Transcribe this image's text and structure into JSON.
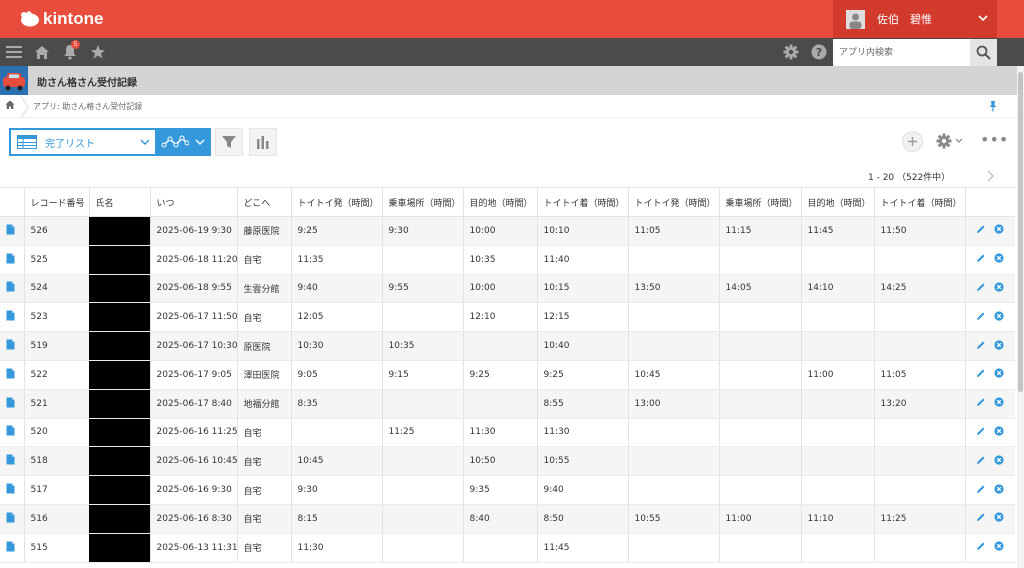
{
  "header": {
    "logo_text": "kintone",
    "user_name": "佐伯　碧惟",
    "brand_color": "#e74c3c"
  },
  "nav": {
    "notification_count": "5",
    "search_placeholder": "アプリ内検索",
    "icons": [
      "menu-icon",
      "home-icon",
      "bell-icon",
      "star-icon",
      "gear-icon",
      "help-icon",
      "search-icon"
    ]
  },
  "app": {
    "title": "助さん格さん受付記録"
  },
  "breadcrumb": {
    "text": "アプリ: 助さん格さん受付記録"
  },
  "toolbar": {
    "view_name": "完了リスト",
    "accent_color": "#3498db"
  },
  "pager": {
    "range": "1 - 20 （522件中）"
  },
  "table": {
    "columns": [
      "",
      "レコード番号",
      "氏名",
      "いつ",
      "どこへ",
      "トイトイ発（時間）",
      "乗車場所（時間）",
      "目的地（時間）",
      "トイトイ着（時間）",
      "トイトイ発（時間）",
      "乗車場所（時間）",
      "目的地（時間）",
      "トイトイ着（時間）",
      ""
    ],
    "rows": [
      {
        "id": "526",
        "name": "",
        "when": "2025-06-19 9:30",
        "where": "藤原医院",
        "c1": "9:25",
        "c2": "9:30",
        "c3": "10:00",
        "c4": "10:10",
        "c5": "11:05",
        "c6": "11:15",
        "c7": "11:45",
        "c8": "11:50"
      },
      {
        "id": "525",
        "name": "",
        "when": "2025-06-18 11:20",
        "where": "自宅",
        "c1": "11:35",
        "c2": "",
        "c3": "10:35",
        "c4": "11:40",
        "c5": "",
        "c6": "",
        "c7": "",
        "c8": ""
      },
      {
        "id": "524",
        "name": "",
        "when": "2025-06-18 9:55",
        "where": "生雲分館",
        "c1": "9:40",
        "c2": "9:55",
        "c3": "10:00",
        "c4": "10:15",
        "c5": "13:50",
        "c6": "14:05",
        "c7": "14:10",
        "c8": "14:25"
      },
      {
        "id": "523",
        "name": "",
        "when": "2025-06-17 11:50",
        "where": "自宅",
        "c1": "12:05",
        "c2": "",
        "c3": "12:10",
        "c4": "12:15",
        "c5": "",
        "c6": "",
        "c7": "",
        "c8": ""
      },
      {
        "id": "519",
        "name": "",
        "when": "2025-06-17 10:30",
        "where": "原医院",
        "c1": "10:30",
        "c2": "10:35",
        "c3": "",
        "c4": "10:40",
        "c5": "",
        "c6": "",
        "c7": "",
        "c8": ""
      },
      {
        "id": "522",
        "name": "",
        "when": "2025-06-17 9:05",
        "where": "澤田医院",
        "c1": "9:05",
        "c2": "9:15",
        "c3": "9:25",
        "c4": "9:25",
        "c5": "10:45",
        "c6": "",
        "c7": "11:00",
        "c8": "11:05"
      },
      {
        "id": "521",
        "name": "",
        "when": "2025-06-17 8:40",
        "where": "地福分館",
        "c1": "8:35",
        "c2": "",
        "c3": "",
        "c4": "8:55",
        "c5": "13:00",
        "c6": "",
        "c7": "",
        "c8": "13:20"
      },
      {
        "id": "520",
        "name": "",
        "when": "2025-06-16 11:25",
        "where": "自宅",
        "c1": "",
        "c2": "11:25",
        "c3": "11:30",
        "c4": "11:30",
        "c5": "",
        "c6": "",
        "c7": "",
        "c8": ""
      },
      {
        "id": "518",
        "name": "",
        "when": "2025-06-16 10:45",
        "where": "自宅",
        "c1": "10:45",
        "c2": "",
        "c3": "10:50",
        "c4": "10:55",
        "c5": "",
        "c6": "",
        "c7": "",
        "c8": ""
      },
      {
        "id": "517",
        "name": "",
        "when": "2025-06-16 9:30",
        "where": "自宅",
        "c1": "9:30",
        "c2": "",
        "c3": "9:35",
        "c4": "9:40",
        "c5": "",
        "c6": "",
        "c7": "",
        "c8": ""
      },
      {
        "id": "516",
        "name": "",
        "when": "2025-06-16 8:30",
        "where": "自宅",
        "c1": "8:15",
        "c2": "",
        "c3": "8:40",
        "c4": "8:50",
        "c5": "10:55",
        "c6": "11:00",
        "c7": "11:10",
        "c8": "11:25"
      },
      {
        "id": "515",
        "name": "",
        "when": "2025-06-13 11:31",
        "where": "自宅",
        "c1": "11:30",
        "c2": "",
        "c3": "",
        "c4": "11:45",
        "c5": "",
        "c6": "",
        "c7": "",
        "c8": ""
      }
    ]
  }
}
